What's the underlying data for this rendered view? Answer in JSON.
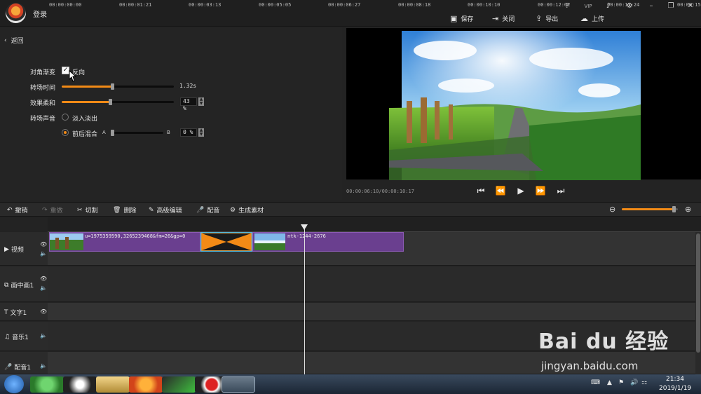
{
  "header": {
    "login": "登录",
    "window_controls": [
      "?",
      "VIP",
      "♪",
      "⚙",
      "–",
      "❐",
      "✕"
    ],
    "actions": [
      {
        "label": "保存",
        "icon": "save-icon"
      },
      {
        "label": "关闭",
        "icon": "exit-icon"
      },
      {
        "label": "导出",
        "icon": "export-icon"
      },
      {
        "label": "上传",
        "icon": "upload-icon"
      }
    ]
  },
  "panel": {
    "back": "返回",
    "diagonal_label": "对角渐变",
    "reverse_label": "反向",
    "transition_time_label": "转场时间",
    "transition_time_value": "1.32s",
    "transition_time_fraction": 0.45,
    "softness_label": "效果柔和",
    "softness_value": "43 %",
    "softness_fraction": 0.43,
    "sound_label": "转场声音",
    "fade_option": "淡入淡出",
    "mix_option": "前后混合",
    "mix_a": "A",
    "mix_b": "B",
    "mix_value": "0 %",
    "mix_fraction": 0.0
  },
  "preview": {
    "timecode": "00:00:06:10/00:00:10:17"
  },
  "edit_toolbar": {
    "undo": "撤销",
    "redo": "重做",
    "cut": "切割",
    "delete": "删除",
    "advanced": "高级编辑",
    "dub": "配音",
    "generate": "生成素材",
    "zoom_fraction": 0.92
  },
  "timeline": {
    "ticks": [
      "00:00:00:00",
      "00:00:01:21",
      "00:00:03:13",
      "00:00:05:05",
      "00:00:06:27",
      "00:00:08:18",
      "00:00:10:10",
      "00:00:12:02",
      "00:00:13:24",
      "00:00:15:"
    ],
    "tracks": {
      "video": "视频",
      "pip": "画中画1",
      "text": "文字1",
      "music": "音乐1",
      "voice": "配音1"
    },
    "clip1_name": "u=1975359590,3265239468&fm=26&gp=0",
    "clip2_name": "ntk-1244-2676"
  },
  "taskbar": {
    "time": "21:34",
    "date": "2019/1/19"
  },
  "watermark": {
    "brand": "Bai du 经验",
    "url": "jingyan.baidu.com"
  },
  "colors": {
    "accent": "#f28a16",
    "clip": "#6a3f8f",
    "transition": "#f28a16"
  }
}
